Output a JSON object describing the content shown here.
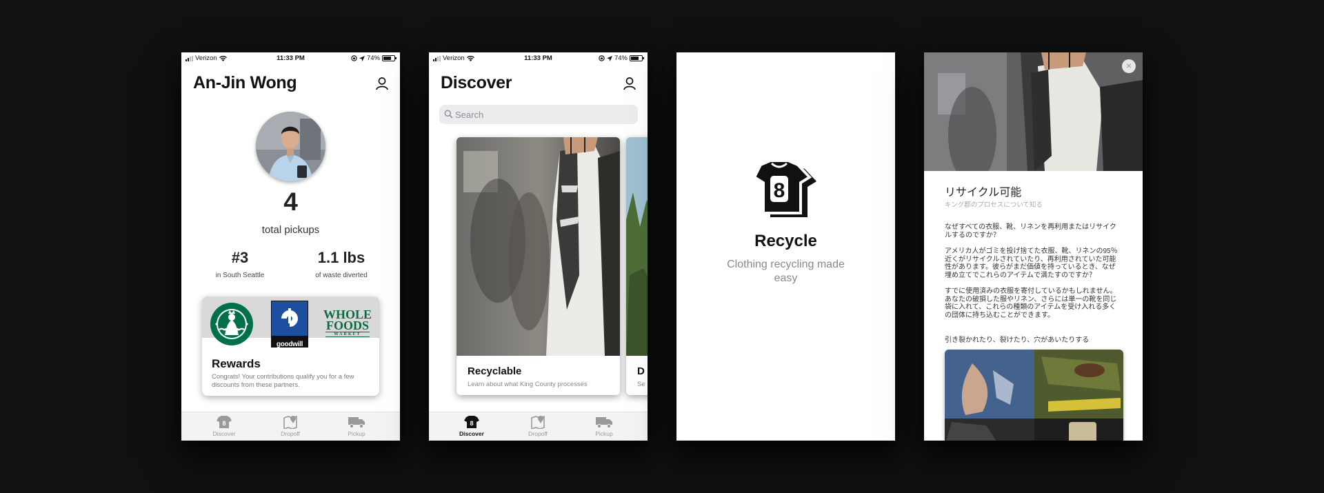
{
  "status_bar": {
    "carrier": "Verizon",
    "time": "11:33 PM",
    "battery": "74%",
    "battery_level": 0.74
  },
  "profile_screen": {
    "title": "An-Jin Wong",
    "pickups_count": "4",
    "pickups_label": "total pickups",
    "rank_value": "#3",
    "rank_label": "in South Seattle",
    "waste_value": "1.1 lbs",
    "waste_label": "of waste diverted",
    "rewards_title": "Rewards",
    "rewards_text": "Congrats! Your contributions qualify you for a few discounts from these partners.",
    "partner_logos": {
      "goodwill_text": "goodwill",
      "wholefoods_line1": "WHOLE",
      "wholefoods_line2": "FOODS",
      "wholefoods_line3": "MARKET"
    }
  },
  "discover_screen": {
    "title": "Discover",
    "search_placeholder": "Search",
    "cards": [
      {
        "title": "Recyclable",
        "subtitle": "Learn about what King County processes"
      },
      {
        "title": "D",
        "subtitle": "Se"
      }
    ]
  },
  "tabs": [
    {
      "label": "Discover",
      "icon": "shirt-icon"
    },
    {
      "label": "Dropoff",
      "icon": "map-pin-icon"
    },
    {
      "label": "Pickup",
      "icon": "truck-icon"
    }
  ],
  "splash_screen": {
    "logo_number": "8",
    "title": "Recycle",
    "subtitle": "Clothing recycling made easy"
  },
  "article_screen": {
    "title": "リサイクル可能",
    "subtitle": "キング郡のプロセスについて知る",
    "paragraphs": [
      "なぜすべての衣服、靴、リネンを再利用またはリサイクルするのですか？",
      "アメリカ人がゴミを投げ捨てた衣服、靴、リネンの95％近くがリサイクルされていたり、再利用されていた可能性があります。彼らがまだ価値を持っているとき、なぜ埋め立てでこれらのアイテムで満たすのですか？",
      "すでに使用済みの衣服を寄付しているかもしれません。あなたの破損した服やリネン、さらには単一の靴を同じ袋に入れて、これらの種類のアイテムを受け入れる多くの団体に持ち込むことができます。"
    ],
    "section_label": "引き裂かれたり、裂けたり、穴があいたりする",
    "close_glyph": "×"
  },
  "colors": {
    "background": "#111111",
    "text": "#111111",
    "muted": "#888888",
    "starbucks_green": "#00704a",
    "goodwill_blue": "#1d4fa0",
    "wholefoods_green": "#0a6b42"
  }
}
